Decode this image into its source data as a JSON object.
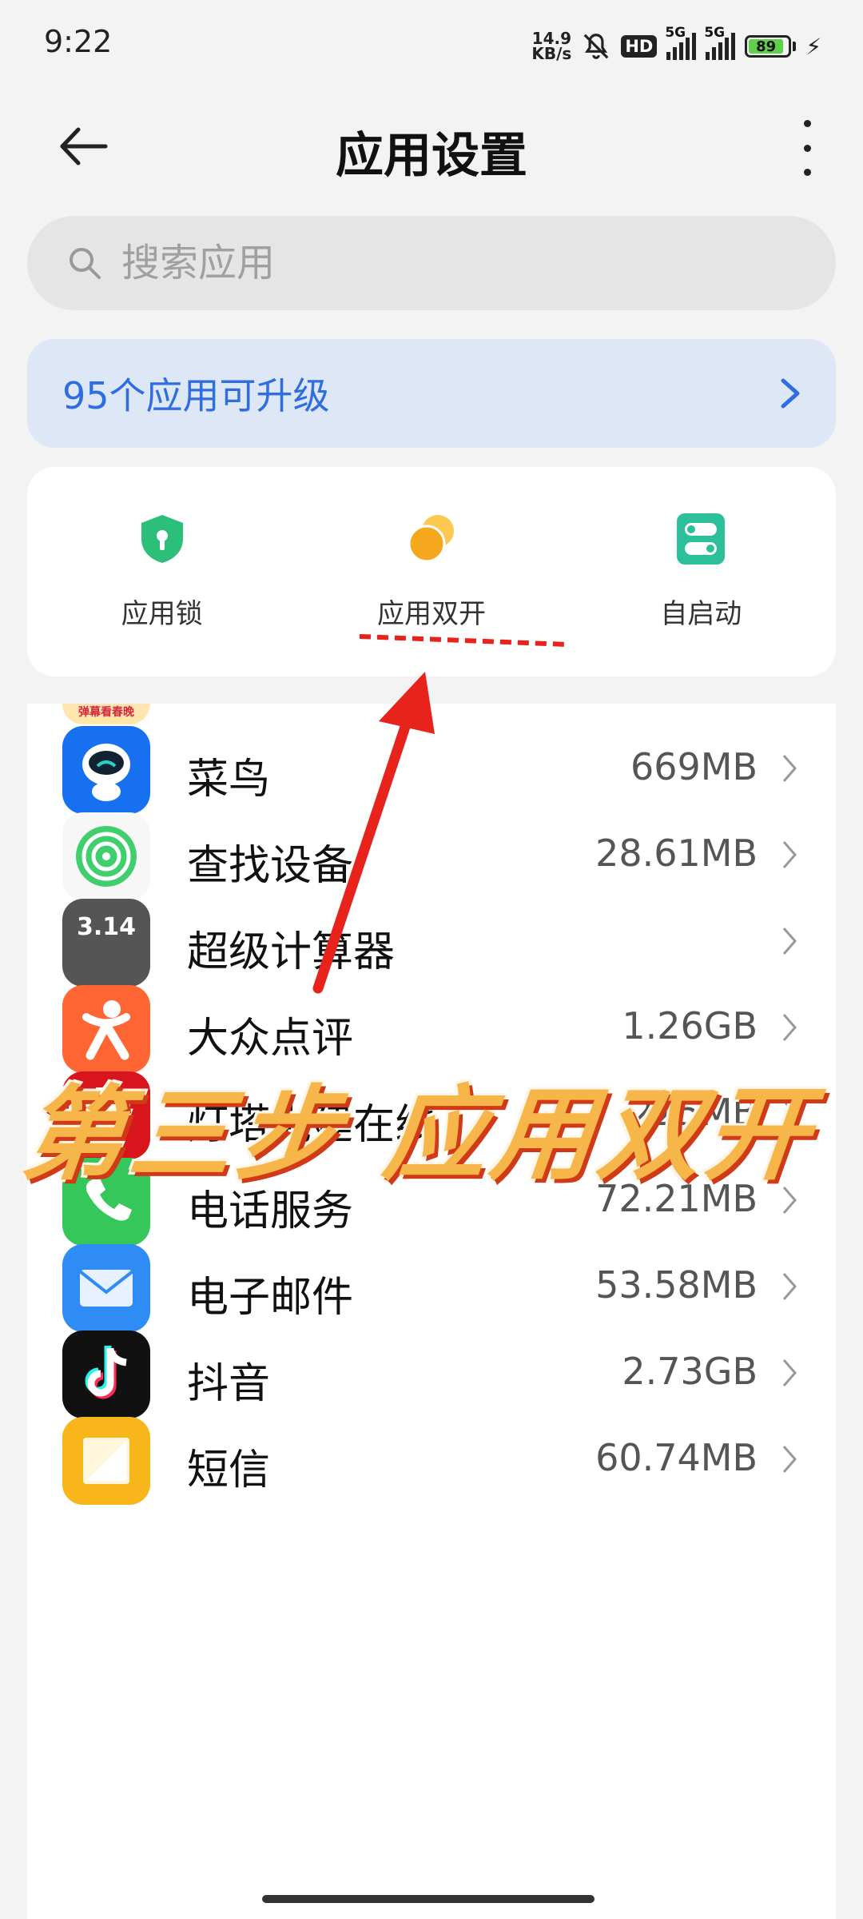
{
  "status_bar": {
    "time": "9:22",
    "net_speed_value": "14.9",
    "net_speed_unit": "KB/s",
    "hd_label": "HD",
    "sim1_label": "5G",
    "sim2_label": "5G",
    "battery_level": "89",
    "battery_color": "#5fd04a"
  },
  "header": {
    "title": "应用设置",
    "back_icon": "arrow-left-icon",
    "more_icon": "more-vertical-icon"
  },
  "search": {
    "placeholder": "搜索应用",
    "icon": "search-icon"
  },
  "upgrade_banner": {
    "text": "95个应用可升级",
    "accent": "#2f6ee0"
  },
  "quick_actions": [
    {
      "label": "应用锁",
      "icon": "shield-lock-icon",
      "color": "#2bbf7a"
    },
    {
      "label": "应用双开",
      "icon": "dual-app-icon",
      "color": "#f5a81d"
    },
    {
      "label": "自启动",
      "icon": "autostart-toggle-icon",
      "color": "#2bbf9a"
    }
  ],
  "apps": [
    {
      "name": "菜鸟",
      "size": "669MB",
      "icon": "cainiao-icon"
    },
    {
      "name": "查找设备",
      "size": "28.61MB",
      "icon": "find-device-icon"
    },
    {
      "name": "超级计算器",
      "size": "",
      "icon": "calculator-icon"
    },
    {
      "name": "大众点评",
      "size": "1.26GB",
      "icon": "dianping-icon"
    },
    {
      "name": "灯塔党建在线",
      "size": "225MB",
      "icon": "lighthouse-icon"
    },
    {
      "name": "电话服务",
      "size": "72.21MB",
      "icon": "phone-icon"
    },
    {
      "name": "电子邮件",
      "size": "53.58MB",
      "icon": "email-icon"
    },
    {
      "name": "抖音",
      "size": "2.73GB",
      "icon": "douyin-icon"
    },
    {
      "name": "短信",
      "size": "60.74MB",
      "icon": "sms-icon"
    }
  ],
  "partial_app_badge": "弹幕看春晚",
  "annotation": {
    "caption": "第三步 应用双开",
    "arrow_color": "#e8231b"
  }
}
